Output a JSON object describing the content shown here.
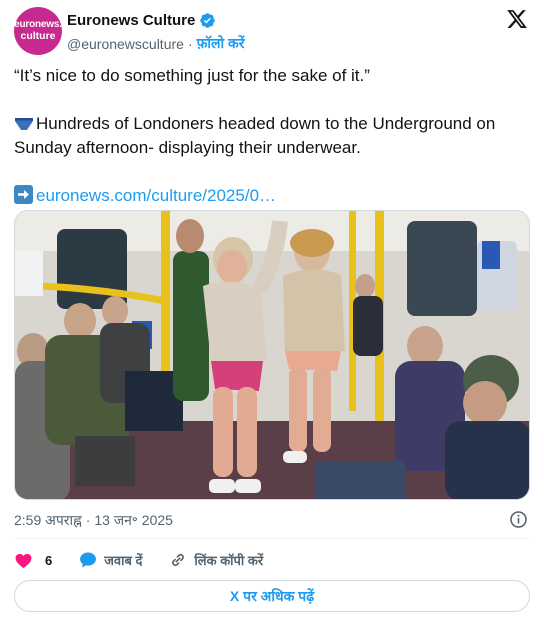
{
  "account": {
    "avatar_line1": "euronews.",
    "avatar_line2": "culture",
    "display_name": "Euronews Culture",
    "handle": "@euronewsculture",
    "separator": "·",
    "follow_label": "फ़ॉलो करें",
    "verified": true
  },
  "tweet": {
    "quote": "“It’s nice to do something just for the sake of it.”",
    "body": "Hundreds of Londoners headed down to the Underground on Sunday afternoon- displaying their underwear.",
    "body_icon": "briefs-icon",
    "link_icon": "right-arrow-icon",
    "link_text": "euronews.com/culture/2025/0…"
  },
  "photo": {
    "subject": "commuters-on-underground-train"
  },
  "meta": {
    "time": "2:59 अपराह्न",
    "separator": "·",
    "date": "13 जन॰ 2025"
  },
  "actions": {
    "like_count": "6",
    "reply_label": "जवाब दें",
    "copy_link_label": "लिंक कॉपी करें"
  },
  "more_button": "X पर अधिक पढ़ें",
  "colors": {
    "accent": "#1d9bf0",
    "like": "#f91880",
    "avatar_bg": "#c7298e",
    "muted": "#536471"
  }
}
